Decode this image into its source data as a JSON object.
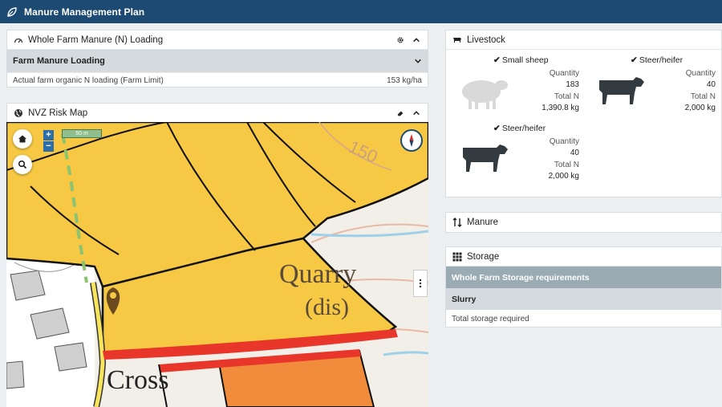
{
  "app": {
    "title": "Manure Management Plan"
  },
  "loading": {
    "title": "Whole Farm Manure (N) Loading",
    "section": "Farm Manure Loading",
    "row_label": "Actual farm organic N loading (Farm Limit)",
    "row_value": "153 kg/ha"
  },
  "map": {
    "title": "NVZ Risk Map",
    "scale_label": "50 m",
    "zoom_in": "+",
    "zoom_out": "−",
    "labels": {
      "quarry": "Quarry",
      "dis": "(dis)",
      "cross": "Cross",
      "contour": "150"
    }
  },
  "livestock": {
    "title": "Livestock",
    "items": [
      {
        "name": "Small sheep",
        "qty_label": "Quantity",
        "qty": "183",
        "n_label": "Total N",
        "n": "1,390.8 kg",
        "icon": "sheep-icon"
      },
      {
        "name": "Steer/heifer",
        "qty_label": "Quantity",
        "qty": "40",
        "n_label": "Total N",
        "n": "2,000 kg",
        "icon": "cow-icon"
      },
      {
        "name": "Steer/heifer",
        "qty_label": "Quantity",
        "qty": "40",
        "n_label": "Total N",
        "n": "2,000 kg",
        "icon": "cow-icon"
      }
    ]
  },
  "manure": {
    "title": "Manure"
  },
  "storage": {
    "title": "Storage",
    "section": "Whole Farm Storage requirements",
    "subsection": "Slurry",
    "row": "Total storage required"
  },
  "colors": {
    "header": "#1c4a72",
    "nvz_yellow": "#f6c844",
    "nvz_orange": "#f08c3c",
    "nvz_red": "#e8372a"
  }
}
